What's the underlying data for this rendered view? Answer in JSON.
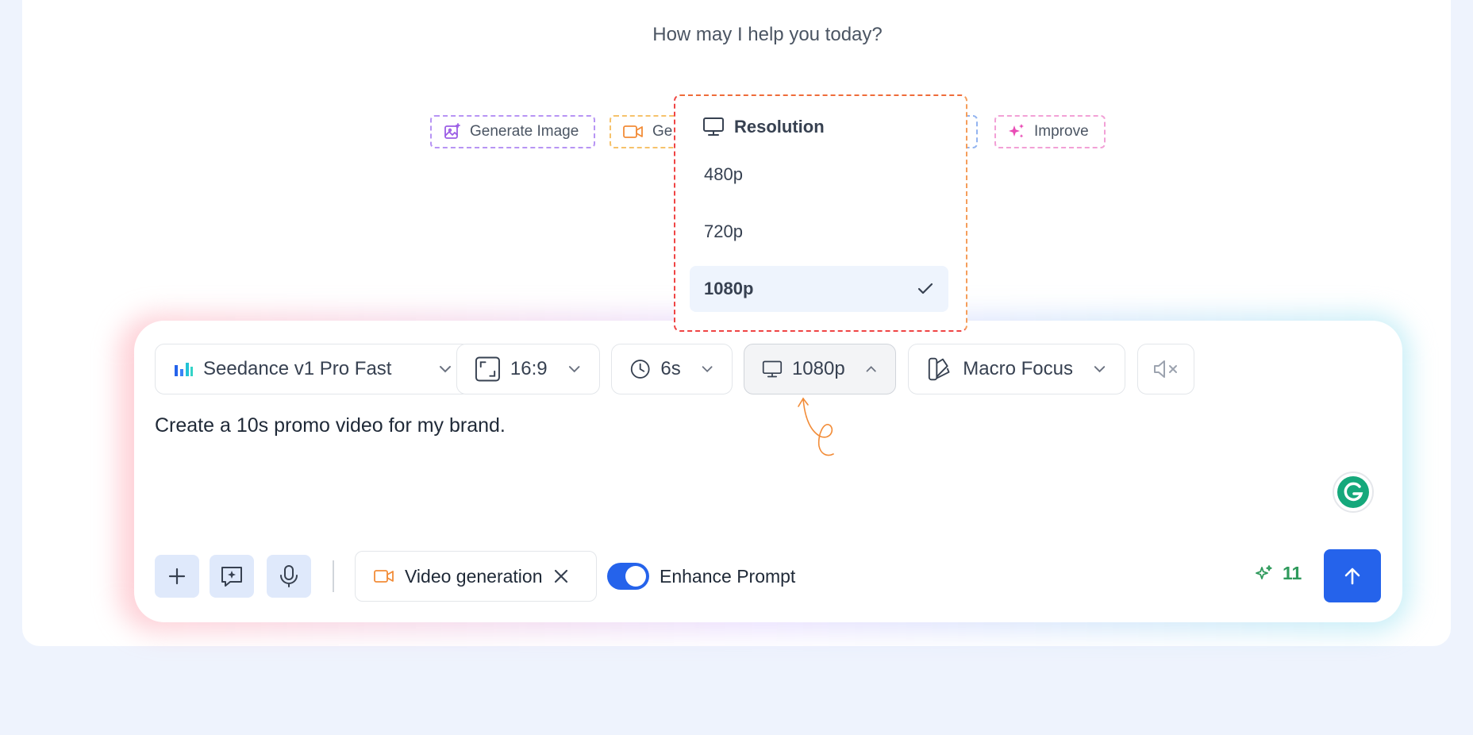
{
  "headline": "How may I help you today?",
  "quick_actions": [
    {
      "label": "Generate Image",
      "icon": "image-sparkle-icon"
    },
    {
      "label": "Ge",
      "icon": "video-camera-icon"
    },
    {
      "label": "Improve",
      "icon": "sparkles-icon"
    }
  ],
  "toolbar": {
    "model": "Seedance v1 Pro Fast",
    "aspect": "16:9",
    "duration": "6s",
    "resolution": "1080p",
    "style": "Macro Focus",
    "mute_icon": "speaker-muted-icon"
  },
  "prompt": {
    "text": "Create a 10s promo video for my brand."
  },
  "bottom_bar": {
    "mode_tag": "Video generation",
    "enhance_label": "Enhance Prompt",
    "enhance_on": true,
    "credits": "11"
  },
  "resolution_menu": {
    "title": "Resolution",
    "options": [
      "480p",
      "720p",
      "1080p"
    ],
    "selected": "1080p"
  },
  "colors": {
    "accent": "#2563eb",
    "credits": "#2f9a5c",
    "video": "#f28c38",
    "image": "#9b5de5",
    "improve": "#e94bb5"
  }
}
